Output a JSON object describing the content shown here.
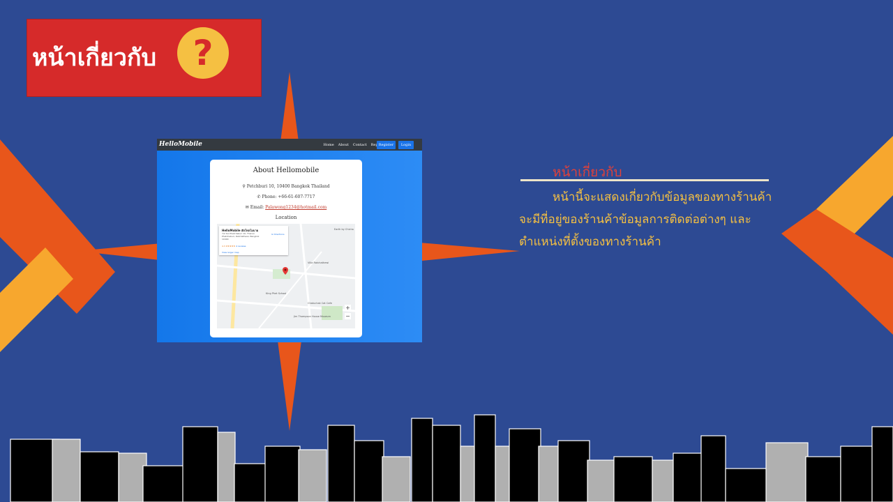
{
  "slide": {
    "title": "หน้าเกี่ยวกับ",
    "title_icon": "question-icon",
    "title_icon_glyph": "?",
    "colors": {
      "background": "#2d4a93",
      "title_box": "#d62a2a",
      "icon_circle": "#f5c042",
      "star_orange": "#e8561b",
      "stripe_yellow": "#f7a72e",
      "heading_red": "#e0413a",
      "description_yellow": "#f5c042"
    }
  },
  "screenshot": {
    "brand": "HelloMobile",
    "nav": [
      "Home",
      "About",
      "Contact",
      "Report"
    ],
    "register_label": "Register",
    "login_label": "Login",
    "card_title": "About Hellomobile",
    "address": "Petchburi 10, 10400 Bangkok Thailand",
    "phone_label": "Phone:",
    "phone": "+66-61-607-7717",
    "email_label": "Email:",
    "email": "Palawong1234@hotmail.com",
    "location_label": "Location",
    "map": {
      "place_name": "HelloMobile ฮัลโหลโมบาย",
      "place_address": "7/2 Soi Phetchaburi 10, Thanon Phetchaburi, Ratchathewi, Bangkok 10400",
      "rating": "4.3 ★★★★★",
      "reviews": "4 reviews",
      "directions_label": "Directions",
      "view_larger": "View larger map",
      "labels": [
        "Earth by Chicha",
        "Villa Ratchathewi",
        "King Phet School",
        "Chatuchak Cat Cafe",
        "Jim Thompson House Museum"
      ],
      "zoom_in": "+",
      "zoom_out": "−"
    }
  },
  "description": {
    "heading": "หน้าเกี่ยวกับ",
    "lines": [
      "หน้านี้จะแสดงเกี่ยวกับข้อมูลของทางร้านค้า",
      "จะมีที่อยู่ของร้านค้าข้อมูลการติดต่อต่างๆ และ",
      "ตำแหน่งที่ตั้งของทางร้านค้า"
    ]
  }
}
